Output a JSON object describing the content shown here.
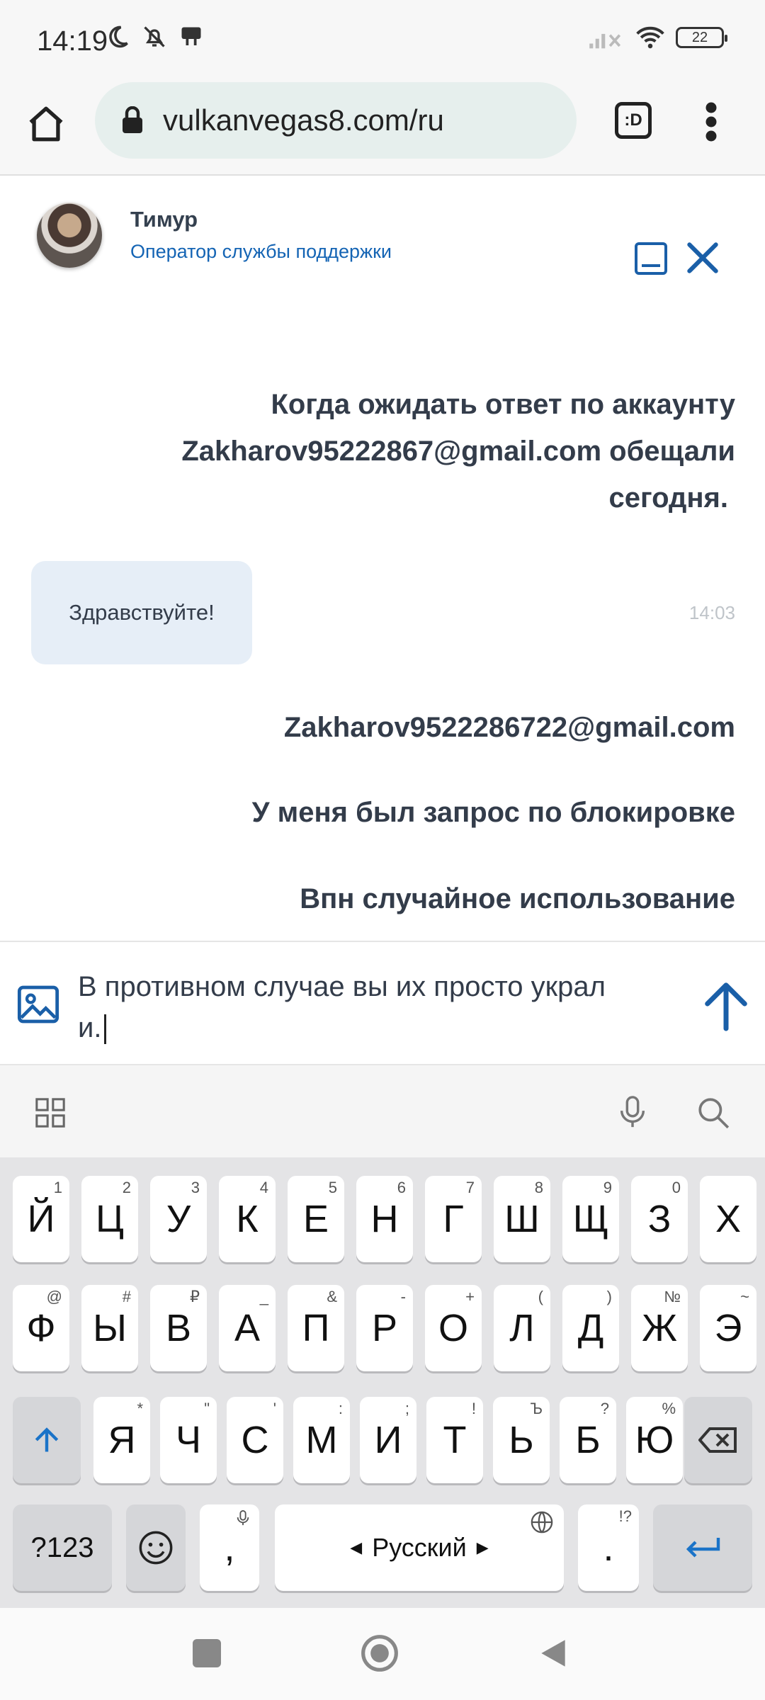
{
  "status_bar": {
    "time": "14:19",
    "battery": "22"
  },
  "browser": {
    "url": "vulkanvegas8.com/ru",
    "tabs_label": ":D"
  },
  "chat_header": {
    "agent_name": "Тимур",
    "agent_role": "Оператор службы поддержки"
  },
  "messages": {
    "user_1": [
      "Когда ожидать ответ по аккаунту",
      "Zakharov95222867@gmail.com обещали",
      "сегодня."
    ],
    "agent_1": {
      "text": "Здравствуйте!",
      "time": "14:03"
    },
    "user_2": "Zakharov9522286722@gmail.com",
    "user_3": "У меня был запрос по блокировке",
    "user_4": "Впн случайное использование"
  },
  "composer": {
    "text_line1": "В противном случае вы их просто украл",
    "text_line2": "и."
  },
  "keyboard": {
    "row1": [
      [
        "Й",
        "1"
      ],
      [
        "Ц",
        "2"
      ],
      [
        "У",
        "3"
      ],
      [
        "К",
        "4"
      ],
      [
        "Е",
        "5"
      ],
      [
        "Н",
        "6"
      ],
      [
        "Г",
        "7"
      ],
      [
        "Ш",
        "8"
      ],
      [
        "Щ",
        "9"
      ],
      [
        "З",
        "0"
      ],
      [
        "Х",
        ""
      ]
    ],
    "row2": [
      [
        "Ф",
        "@"
      ],
      [
        "Ы",
        "#"
      ],
      [
        "В",
        "₽"
      ],
      [
        "А",
        "_"
      ],
      [
        "П",
        "&"
      ],
      [
        "Р",
        "-"
      ],
      [
        "О",
        "+"
      ],
      [
        "Л",
        "("
      ],
      [
        "Д",
        ")"
      ],
      [
        "Ж",
        "№"
      ],
      [
        "Э",
        "~"
      ]
    ],
    "row3": [
      [
        "Я",
        "*"
      ],
      [
        "Ч",
        "\""
      ],
      [
        "С",
        "'"
      ],
      [
        "М",
        ":"
      ],
      [
        "И",
        ";"
      ],
      [
        "Т",
        "!"
      ],
      [
        "Ь",
        "Ъ"
      ],
      [
        "Б",
        "?"
      ],
      [
        "Ю",
        "%"
      ]
    ],
    "sym_key": "?123",
    "comma_key": ",",
    "space_label": "Русский",
    "period_key": ".",
    "period_hint": "!?"
  }
}
